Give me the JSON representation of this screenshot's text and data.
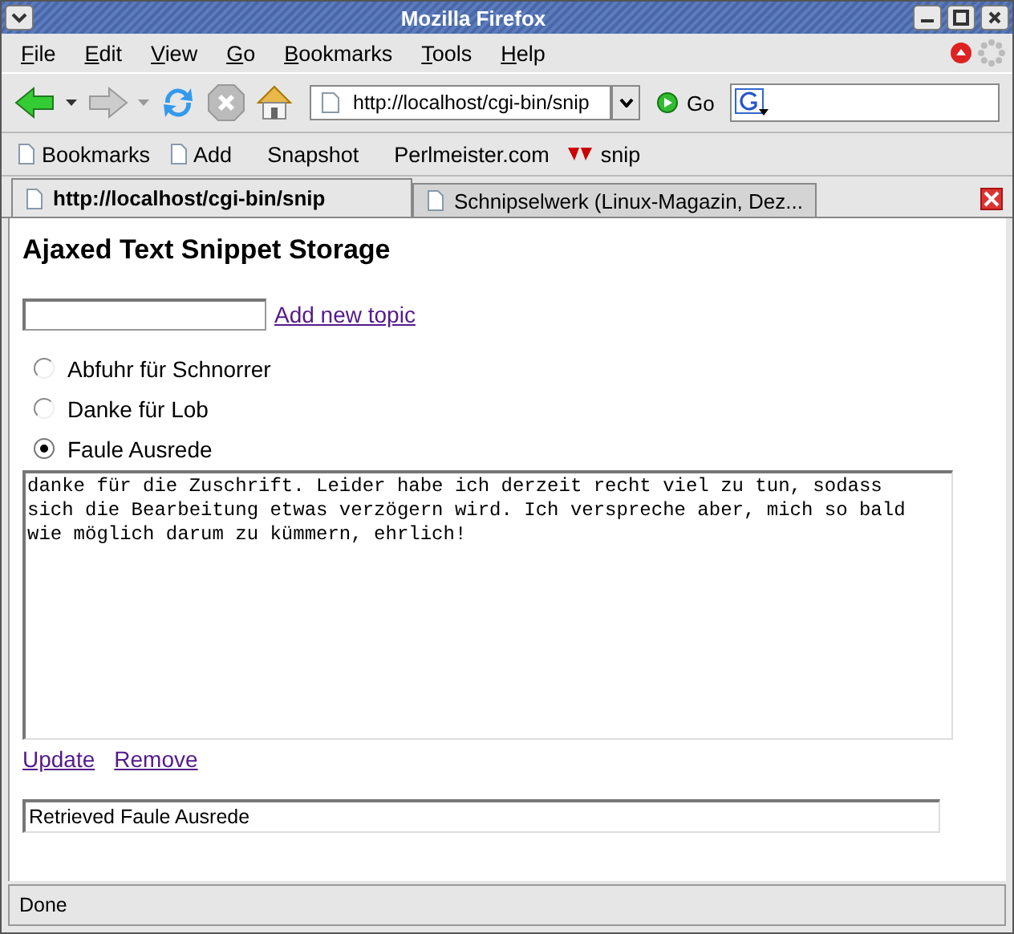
{
  "window": {
    "title": "Mozilla Firefox"
  },
  "menu": [
    "File",
    "Edit",
    "View",
    "Go",
    "Bookmarks",
    "Tools",
    "Help"
  ],
  "toolbar": {
    "url": "http://localhost/cgi-bin/snip",
    "go": "Go"
  },
  "bookmarks": [
    {
      "label": "Bookmarks",
      "kind": "page"
    },
    {
      "label": "Add",
      "kind": "page"
    },
    {
      "label": "Snapshot",
      "kind": "plain"
    },
    {
      "label": "Perlmeister.com",
      "kind": "plain"
    },
    {
      "label": "snip",
      "kind": "yahoo"
    }
  ],
  "tabs": [
    {
      "label": "http://localhost/cgi-bin/snip",
      "selected": true
    },
    {
      "label": "Schnipselwerk (Linux-Magazin, Dez...",
      "selected": false
    }
  ],
  "page": {
    "heading": "Ajaxed Text Snippet Storage",
    "add_link": "Add new topic",
    "topics": [
      {
        "label": "Abfuhr für Schnorrer",
        "selected": false
      },
      {
        "label": "Danke für Lob",
        "selected": false
      },
      {
        "label": "Faule Ausrede",
        "selected": true
      }
    ],
    "snippet": "danke für die Zuschrift. Leider habe ich derzeit recht viel zu tun, sodass sich die Bearbeitung etwas verzögern wird. Ich verspreche aber, mich so bald wie möglich darum zu kümmern, ehrlich!",
    "actions": [
      "Update",
      "Remove"
    ],
    "message": "Retrieved Faule Ausrede"
  },
  "status_bar": "Done"
}
